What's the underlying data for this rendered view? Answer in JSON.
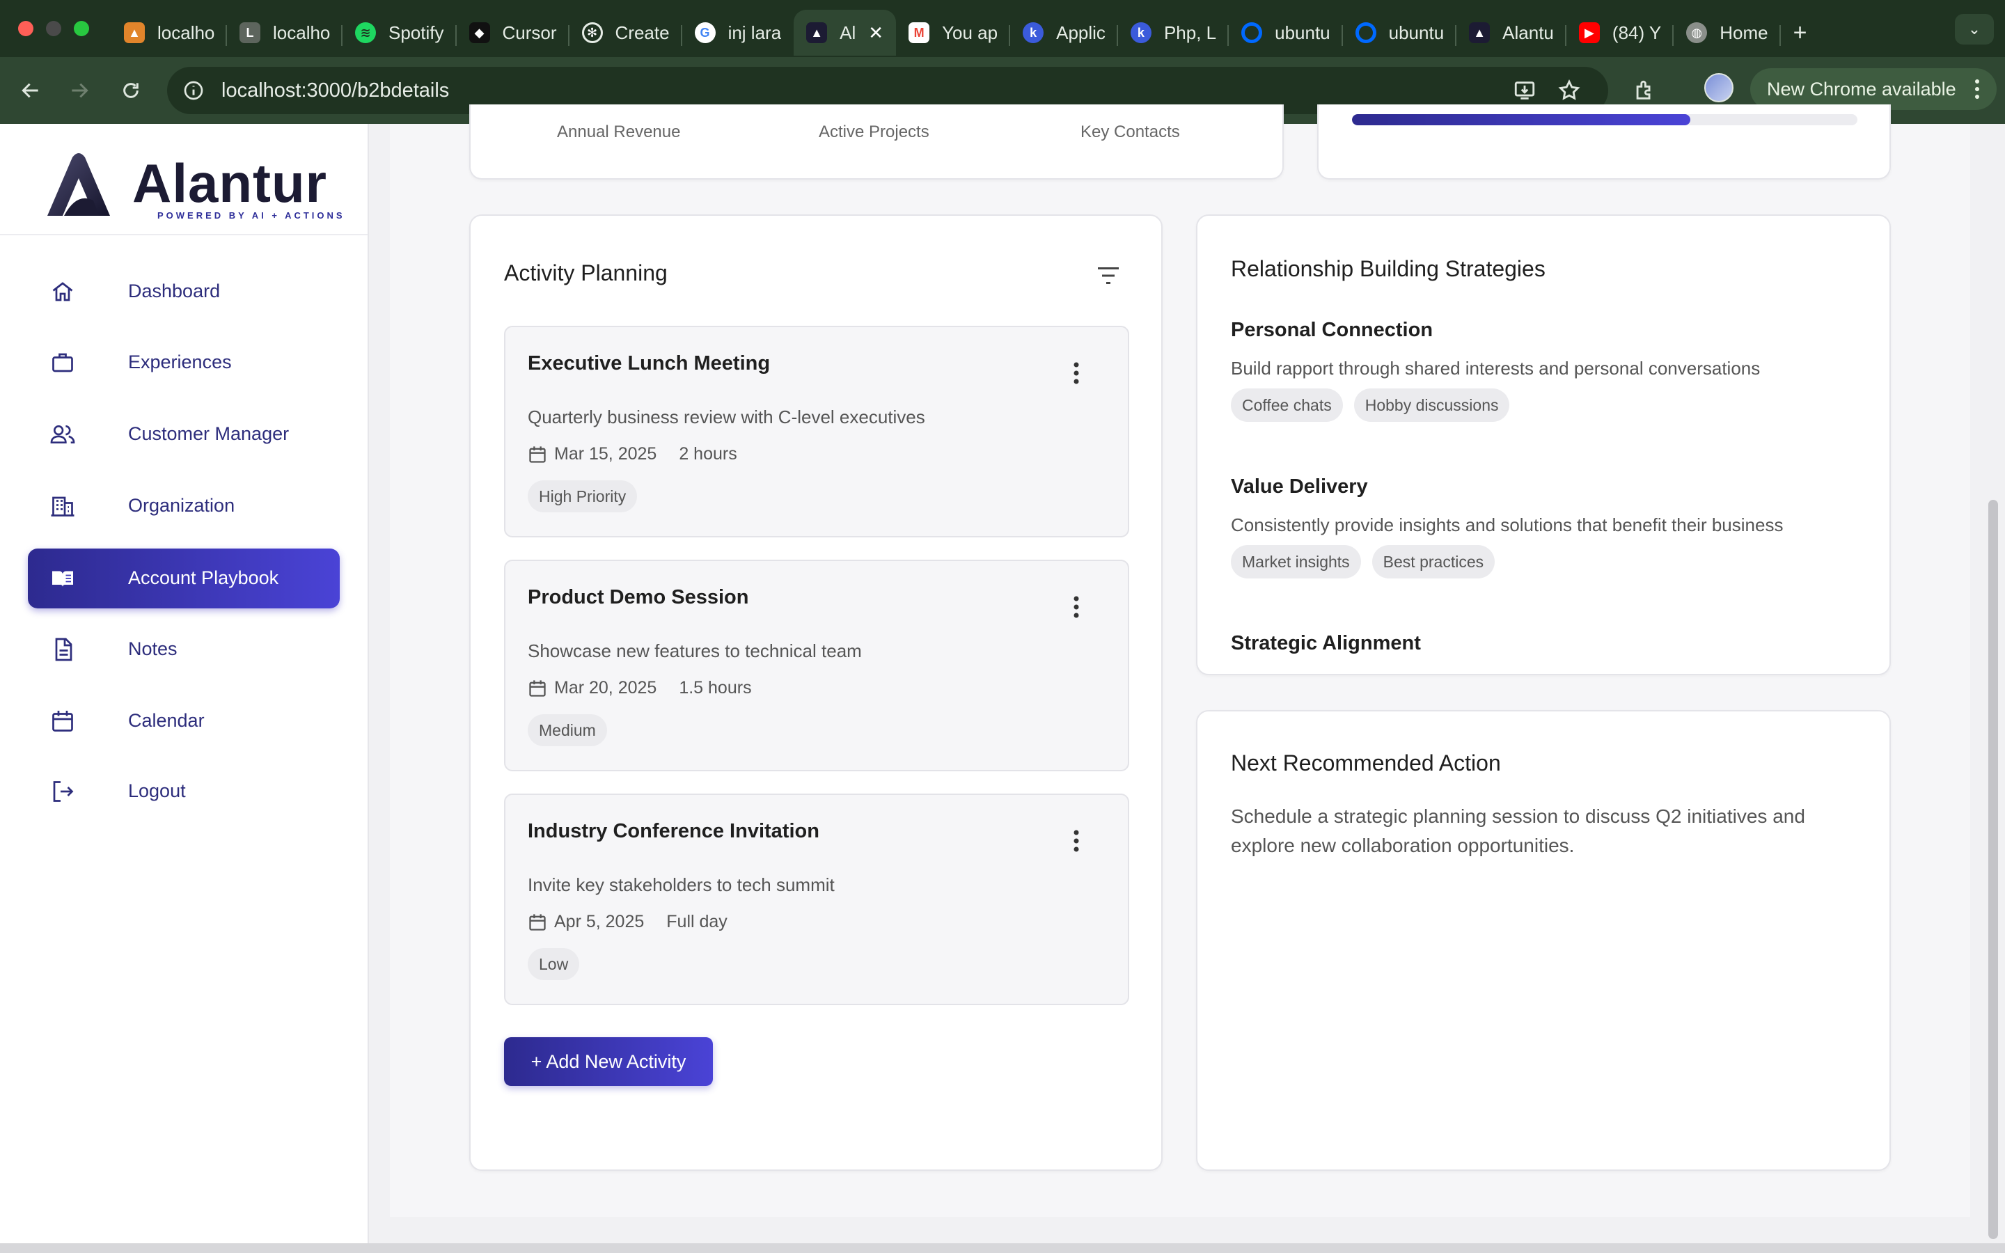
{
  "browser": {
    "tabs": [
      {
        "label": "localho",
        "favicon": "alantur-mountain-icon",
        "color": "#e1852b"
      },
      {
        "label": "localho",
        "favicon": "laravel-icon",
        "color": "#8a8f8a"
      },
      {
        "label": "Spotify",
        "favicon": "spotify-icon",
        "color": "#1ed760"
      },
      {
        "label": "Cursor",
        "favicon": "cursor-icon",
        "color": "#111111"
      },
      {
        "label": "Create",
        "favicon": "openai-icon",
        "color": "#2f4732"
      },
      {
        "label": "inj lara",
        "favicon": "google-icon",
        "color": "#ffffff"
      },
      {
        "label": "Al",
        "favicon": "alantur-icon",
        "color": "#2f4732",
        "active": true
      },
      {
        "label": "You ap",
        "favicon": "gmail-icon",
        "color": "#ea4335"
      },
      {
        "label": "Applic",
        "favicon": "clickup-icon",
        "color": "#3b5bdb"
      },
      {
        "label": "Php, L",
        "favicon": "clickup-icon",
        "color": "#3b5bdb"
      },
      {
        "label": "ubuntu",
        "favicon": "digitalocean-icon",
        "color": "#0069ff"
      },
      {
        "label": "ubuntu",
        "favicon": "digitalocean-icon",
        "color": "#0069ff"
      },
      {
        "label": "Alantu",
        "favicon": "alantur-icon",
        "color": "#2f4732"
      },
      {
        "label": "(84) Y",
        "favicon": "youtube-icon",
        "color": "#ff0000"
      },
      {
        "label": "Home",
        "favicon": "globe-icon",
        "color": "#8a8f8a"
      }
    ],
    "url": "localhost:3000/b2bdetails",
    "update_label": "New Chrome available"
  },
  "brand": {
    "name": "Alantur",
    "tagline": "POWERED BY AI + ACTIONS"
  },
  "sidebar": {
    "items": [
      {
        "label": "Dashboard",
        "icon": "home-icon"
      },
      {
        "label": "Experiences",
        "icon": "briefcase-icon"
      },
      {
        "label": "Customer Manager",
        "icon": "users-icon"
      },
      {
        "label": "Organization",
        "icon": "building-icon"
      },
      {
        "label": "Account Playbook",
        "icon": "book-icon",
        "active": true
      },
      {
        "label": "Notes",
        "icon": "document-icon"
      },
      {
        "label": "Calendar",
        "icon": "calendar-icon"
      },
      {
        "label": "Logout",
        "icon": "logout-icon"
      }
    ]
  },
  "stats": {
    "labels": [
      "Annual Revenue",
      "Active Projects",
      "Key Contacts"
    ]
  },
  "progress": {
    "value_fraction": 0.67,
    "accent": "#3b37c0"
  },
  "activity_planning": {
    "title": "Activity Planning",
    "activities": [
      {
        "title": "Executive Lunch Meeting",
        "description": "Quarterly business review with C-level executives",
        "date": "Mar 15, 2025",
        "duration": "2 hours",
        "priority": "High Priority"
      },
      {
        "title": "Product Demo Session",
        "description": "Showcase new features to technical team",
        "date": "Mar 20, 2025",
        "duration": "1.5 hours",
        "priority": "Medium"
      },
      {
        "title": "Industry Conference Invitation",
        "description": "Invite key stakeholders to tech summit",
        "date": "Apr 5, 2025",
        "duration": "Full day",
        "priority": "Low"
      }
    ],
    "add_label": "+ Add New Activity"
  },
  "strategies": {
    "title": "Relationship Building Strategies",
    "items": [
      {
        "title": "Personal Connection",
        "description": "Build rapport through shared interests and personal conversations",
        "tags": [
          "Coffee chats",
          "Hobby discussions"
        ]
      },
      {
        "title": "Value Delivery",
        "description": "Consistently provide insights and solutions that benefit their business",
        "tags": [
          "Market insights",
          "Best practices"
        ]
      },
      {
        "title": "Strategic Alignment",
        "description": "",
        "tags": []
      }
    ]
  },
  "next_action": {
    "title": "Next Recommended Action",
    "text": "Schedule a strategic planning session to discuss Q2 initiatives and explore new collaboration opportunities."
  },
  "colors": {
    "brand_primary": "#2d2a8f",
    "brand_secondary": "#4a43d6",
    "chrome_dark": "#1f3321",
    "chrome_toolbar": "#2f4732"
  }
}
